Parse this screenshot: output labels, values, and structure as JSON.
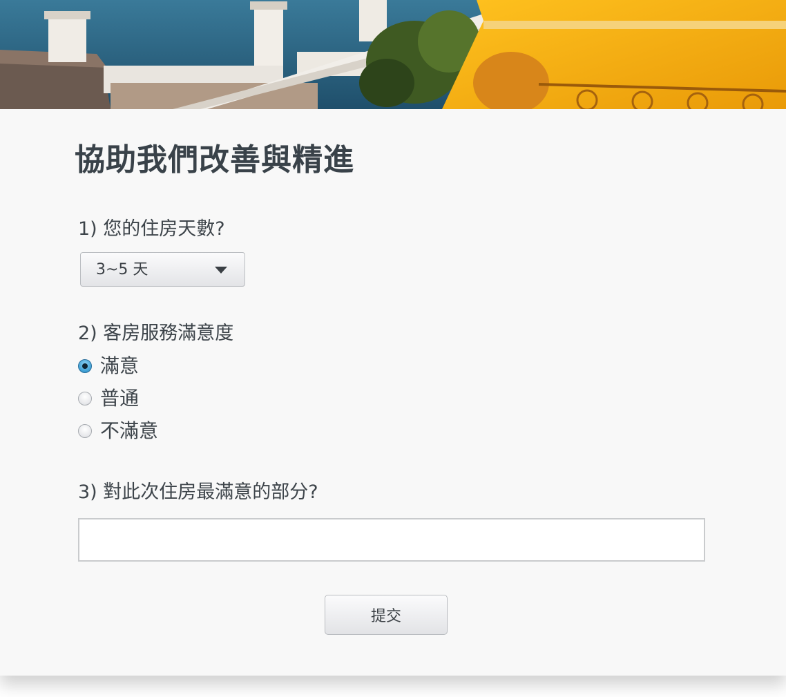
{
  "form": {
    "title": "協助我們改善與精進",
    "q1": {
      "label": "1) 您的住房天數?",
      "selected": "3~5 天"
    },
    "q2": {
      "label": "2) 客房服務滿意度",
      "options": [
        "滿意",
        "普通",
        "不滿意"
      ],
      "selected": "滿意"
    },
    "q3": {
      "label": "3) 對此次住房最滿意的部分?",
      "value": ""
    },
    "submit_label": "提交"
  },
  "colors": {
    "background": "#f8f8f8",
    "text": "#3d444a",
    "radio_checked": "#3e9fd4",
    "banner_yellow": "#f7b017",
    "banner_sea": "#2f6f90"
  },
  "icons": {
    "select_arrow": "chevron-down-icon"
  }
}
